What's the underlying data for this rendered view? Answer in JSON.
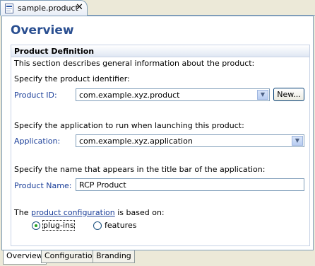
{
  "editor_tab": {
    "title": "sample.product",
    "close_glyph": "✕",
    "icon": "file-icon"
  },
  "page_title": "Overview",
  "section": {
    "title": "Product Definition",
    "description": "This section describes general information about the product:",
    "identifier_prompt": "Specify the product identifier:",
    "product_id_label": "Product ID:",
    "product_id_value": "com.example.xyz.product",
    "new_button": "New...",
    "application_prompt": "Specify the application to run when launching this product:",
    "application_label": "Application:",
    "application_value": "com.example.xyz.application",
    "name_prompt": "Specify the name that appears in the title bar of the application:",
    "product_name_label": "Product Name:",
    "product_name_value": "RCP Product",
    "config_prefix": "The ",
    "config_link": "product configuration",
    "config_suffix": " is based on:",
    "radio_plugins": "plug-ins",
    "radio_features": "features",
    "selected": "plug-ins"
  },
  "bottom_tabs": [
    "Overview",
    "Configuration",
    "Branding"
  ],
  "active_tab": "Overview",
  "colors": {
    "title": "#2a4f91",
    "link": "#1a3e99",
    "border": "#7f9db9"
  }
}
